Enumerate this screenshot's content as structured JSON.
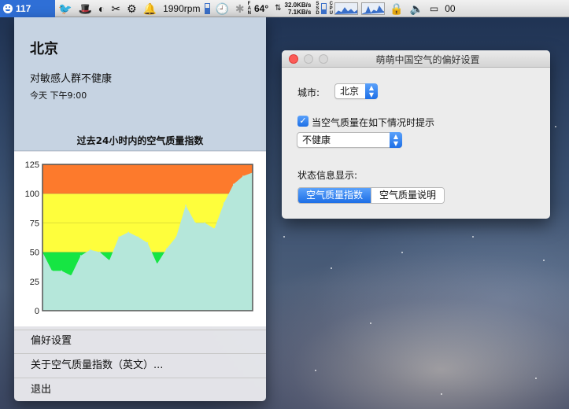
{
  "menubar": {
    "aqi_value": "117",
    "fan_speed": "1990rpm",
    "temperature": "64°",
    "net_up": "32.0KB/s",
    "net_down": "7.1KB/s",
    "clock_partial": "00",
    "colors": {
      "aqi_badge": "#2f6fd6"
    }
  },
  "menu": {
    "city": "北京",
    "health": "对敏感人群不健康",
    "time": "今天 下午9:00",
    "chart_title": "过去24小时内的空气质量指数",
    "items": [
      {
        "label": "偏好设置"
      },
      {
        "label": "关于空气质量指数（英文）..."
      },
      {
        "label": "退出"
      }
    ]
  },
  "prefs": {
    "title": "萌萌中国空气的偏好设置",
    "city_label": "城市:",
    "city_value": "北京",
    "alert_label": "当空气质量在如下情况时提示",
    "alert_checked": true,
    "alert_level": "不健康",
    "status_label": "状态信息显示:",
    "status_options": [
      "空气质量指数",
      "空气质量说明"
    ],
    "status_selected": 0
  },
  "chart_data": {
    "type": "area",
    "title": "",
    "xlabel": "",
    "ylabel": "",
    "ylim": [
      0,
      125
    ],
    "yticks": [
      0,
      25,
      50,
      75,
      100,
      125
    ],
    "bands": [
      {
        "from": 0,
        "to": 50,
        "color": "#16e543"
      },
      {
        "from": 50,
        "to": 100,
        "color": "#fefe3c"
      },
      {
        "from": 100,
        "to": 125,
        "color": "#fd7a2c"
      }
    ],
    "fill_color": "#b5e7da",
    "values": [
      50,
      34,
      34,
      30,
      47,
      52,
      50,
      43,
      63,
      67,
      63,
      58,
      40,
      53,
      63,
      90,
      75,
      75,
      70,
      92,
      108,
      115,
      118
    ]
  }
}
